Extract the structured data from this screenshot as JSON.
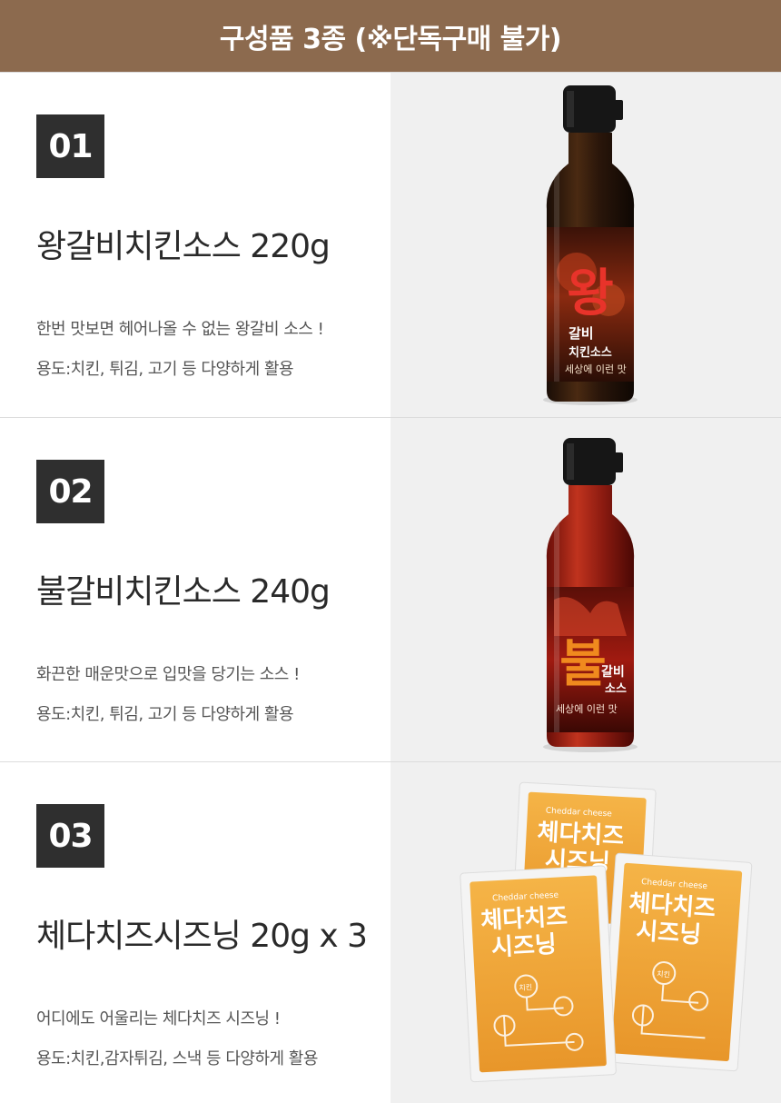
{
  "header": {
    "title": "구성품 3종 (※단독구매 불가)"
  },
  "items": [
    {
      "number": "01",
      "name": "왕갈비치킨소스 220g",
      "description": "한번 맛보면 헤어나올 수 없는 왕갈비 소스 !",
      "usage": "용도:치킨, 튀김, 고기 등 다양하게 활용",
      "label_big": "왕",
      "label_small": "갈비",
      "label_sub": "치킨소스",
      "label_tag": "세상에 이런 맛",
      "image_icon": "sauce-bottle-icon"
    },
    {
      "number": "02",
      "name": "불갈비치킨소스 240g",
      "description": "화끈한 매운맛으로 입맛을 당기는 소스 !",
      "usage": "용도:치킨, 튀김, 고기 등 다양하게 활용",
      "label_big": "불",
      "label_small": "갈비",
      "label_sub": "소스",
      "label_tag": "세상에 이런 맛",
      "image_icon": "sauce-bottle-icon"
    },
    {
      "number": "03",
      "name": "체다치즈시즈닝 20g x 3",
      "description": "어디에도 어울리는 체다치즈 시즈닝 !",
      "usage": "용도:치킨,감자튀김, 스낵 등 다양하게 활용",
      "label_small_en": "Cheddar cheese",
      "label_line1": "체다치즈",
      "label_line2": "시즈닝",
      "label_tag": "치킨",
      "image_icon": "seasoning-packet-icon"
    }
  ],
  "colors": {
    "header_bg": "#8c6a4e",
    "badge_bg": "#2f2f2f",
    "image_bg": "#f0f0f0",
    "packet_orange": "#f2a535"
  }
}
